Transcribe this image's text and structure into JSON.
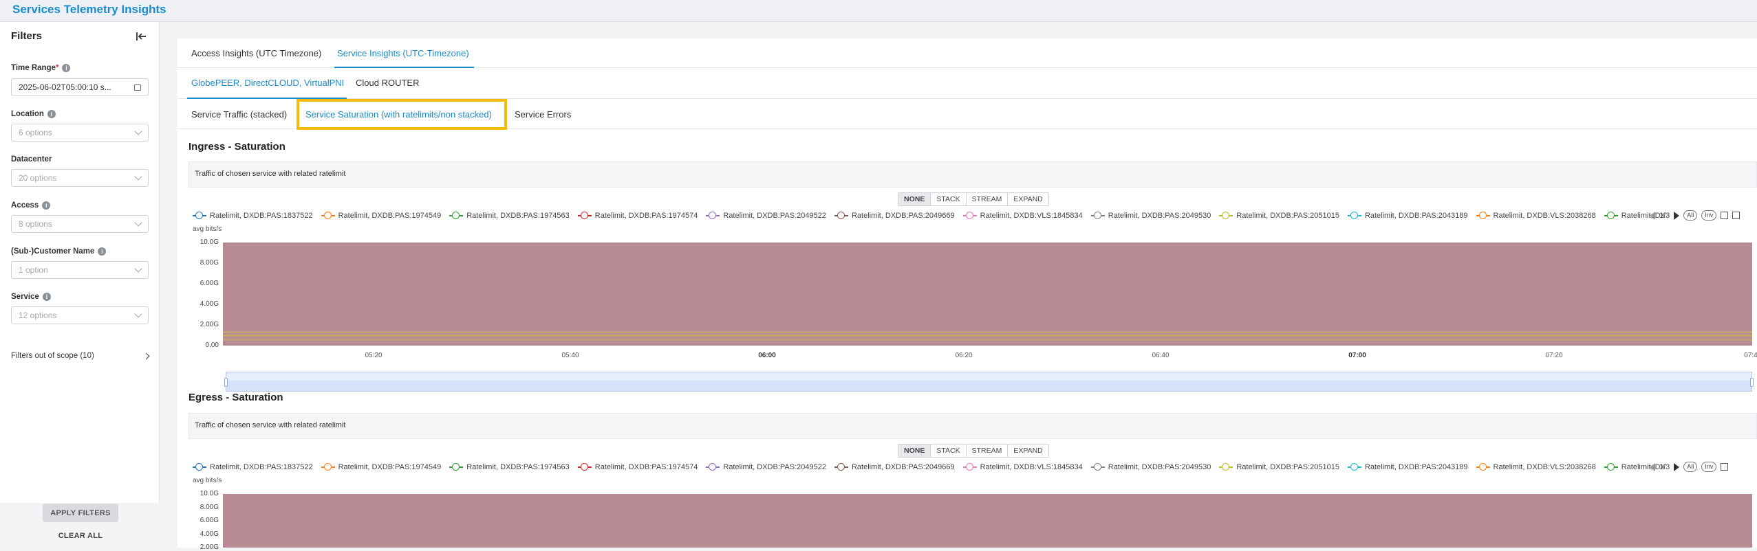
{
  "app": {
    "title": "Services Telemetry Insights"
  },
  "sidebar": {
    "heading": "Filters",
    "time_range": {
      "label": "Time Range",
      "required_mark": "*",
      "value": "2025-06-02T05:00:10 s..."
    },
    "location": {
      "label": "Location",
      "placeholder": "6 options"
    },
    "datacenter": {
      "label": "Datacenter",
      "placeholder": "20 options"
    },
    "access": {
      "label": "Access",
      "placeholder": "8 options"
    },
    "customer": {
      "label": "(Sub-)Customer Name",
      "placeholder": "1 option"
    },
    "service": {
      "label": "Service",
      "placeholder": "12 options"
    },
    "out_of_scope": "Filters out of scope (10)",
    "apply_label": "APPLY FILTERS",
    "clear_label": "CLEAR ALL"
  },
  "tabs_primary": [
    "Access Insights (UTC Timezone)",
    "Service Insights (UTC-Timezone)"
  ],
  "tabs_secondary": [
    "GlobePEER, DirectCLOUD, VirtualPNI",
    "Cloud ROUTER"
  ],
  "tabs_tertiary": [
    "Service Traffic (stacked)",
    "Service Saturation (with ratelimits/non stacked)",
    "Service Errors"
  ],
  "mode_buttons": [
    "NONE",
    "STACK",
    "STREAM",
    "EXPAND"
  ],
  "legend_items": [
    {
      "label": "Ratelimit, DXDB:PAS:1837522",
      "color": "#1f77b4"
    },
    {
      "label": "Ratelimit, DXDB:PAS:1974549",
      "color": "#ff7f0e"
    },
    {
      "label": "Ratelimit, DXDB:PAS:1974563",
      "color": "#2ca02c"
    },
    {
      "label": "Ratelimit, DXDB:PAS:1974574",
      "color": "#d62728"
    },
    {
      "label": "Ratelimit, DXDB:PAS:2049522",
      "color": "#9467bd"
    },
    {
      "label": "Ratelimit, DXDB:PAS:2049669",
      "color": "#8c564b"
    },
    {
      "label": "Ratelimit, DXDB:VLS:1845834",
      "color": "#e377c2"
    },
    {
      "label": "Ratelimit, DXDB:PAS:2049530",
      "color": "#7f7f7f"
    },
    {
      "label": "Ratelimit, DXDB:PAS:2051015",
      "color": "#bcbd22"
    },
    {
      "label": "Ratelimit, DXDB:PAS:2043189",
      "color": "#17becf"
    },
    {
      "label": "Ratelimit, DXDB:VLS:2038268",
      "color": "#ff7f0e"
    },
    {
      "label": "Ratelimit, DX",
      "color": "#2ca02c"
    }
  ],
  "legend_pager": {
    "page": "1/3",
    "all_label": "All",
    "inv_label": "Inv"
  },
  "ingress": {
    "title": "Ingress - Saturation",
    "description": "Traffic of chosen service with related ratelimit",
    "unit": "avg bits/s",
    "y_ticks": [
      "10.0G",
      "8.00G",
      "6.00G",
      "4.00G",
      "2.00G",
      "0.00"
    ],
    "x_ticks": [
      {
        "label": "05:20",
        "bold": false
      },
      {
        "label": "05:40",
        "bold": false
      },
      {
        "label": "06:00",
        "bold": true
      },
      {
        "label": "06:20",
        "bold": false
      },
      {
        "label": "06:40",
        "bold": false
      },
      {
        "label": "07:00",
        "bold": true
      },
      {
        "label": "07:20",
        "bold": false
      },
      {
        "label": "07:4",
        "bold": false
      }
    ]
  },
  "egress": {
    "title": "Egress - Saturation",
    "description": "Traffic of chosen service with related ratelimit",
    "unit": "avg bits/s",
    "y_ticks": [
      "10.0G",
      "8.00G",
      "6.00G",
      "4.00G",
      "2.00G"
    ]
  },
  "colors": {
    "accent": "#1a8ac9",
    "highlight": "#f6b90e",
    "area": "#b88a94"
  }
}
